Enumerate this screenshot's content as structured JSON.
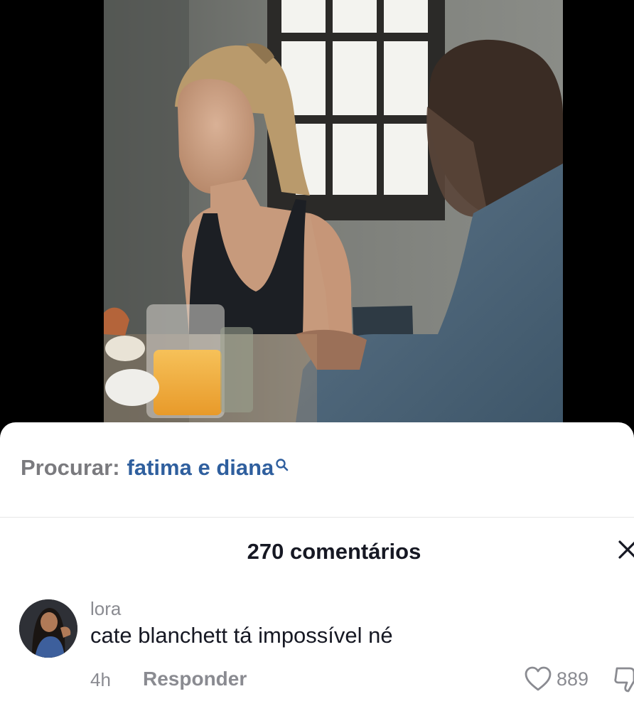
{
  "search": {
    "prefix": "Procurar:",
    "query": "fatima e diana",
    "icon": "search-icon"
  },
  "comments_panel": {
    "title": "270 comentários",
    "close_icon": "close-icon"
  },
  "comments": [
    {
      "username": "lora",
      "text": "cate blanchett tá impossível né",
      "time": "4h",
      "reply_label": "Responder",
      "likes": "889"
    }
  ],
  "colors": {
    "search_query": "#2f5f9e",
    "secondary_text": "#8a8b91",
    "primary_text": "#161823"
  }
}
